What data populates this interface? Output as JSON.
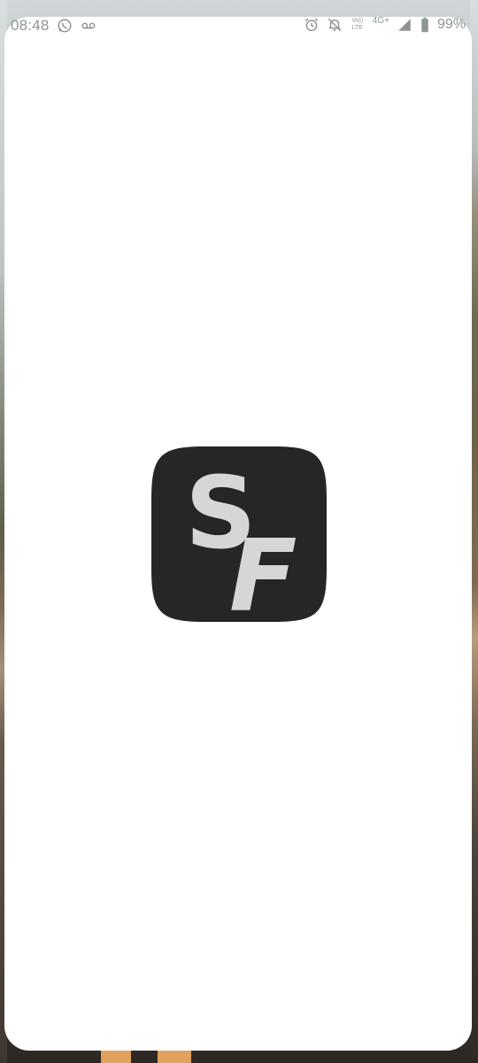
{
  "status_bar": {
    "time": "08:48",
    "network_label_top": "Vo))",
    "network_label_bottom": "LTE",
    "network_type": "4G+",
    "battery_percent": "99%"
  },
  "splash": {
    "logo_text": "SF",
    "logo_background": "#262626",
    "logo_letter_color": "#d6d6d6"
  },
  "colors": {
    "card_background": "#ffffff",
    "status_text": "#8f9497"
  },
  "icons": {
    "status_left": [
      "whatsapp-icon",
      "voicemail-icon"
    ],
    "status_right": [
      "alarm-icon",
      "notifications-off-icon",
      "volte-icon",
      "signal-icon",
      "battery-icon"
    ]
  }
}
